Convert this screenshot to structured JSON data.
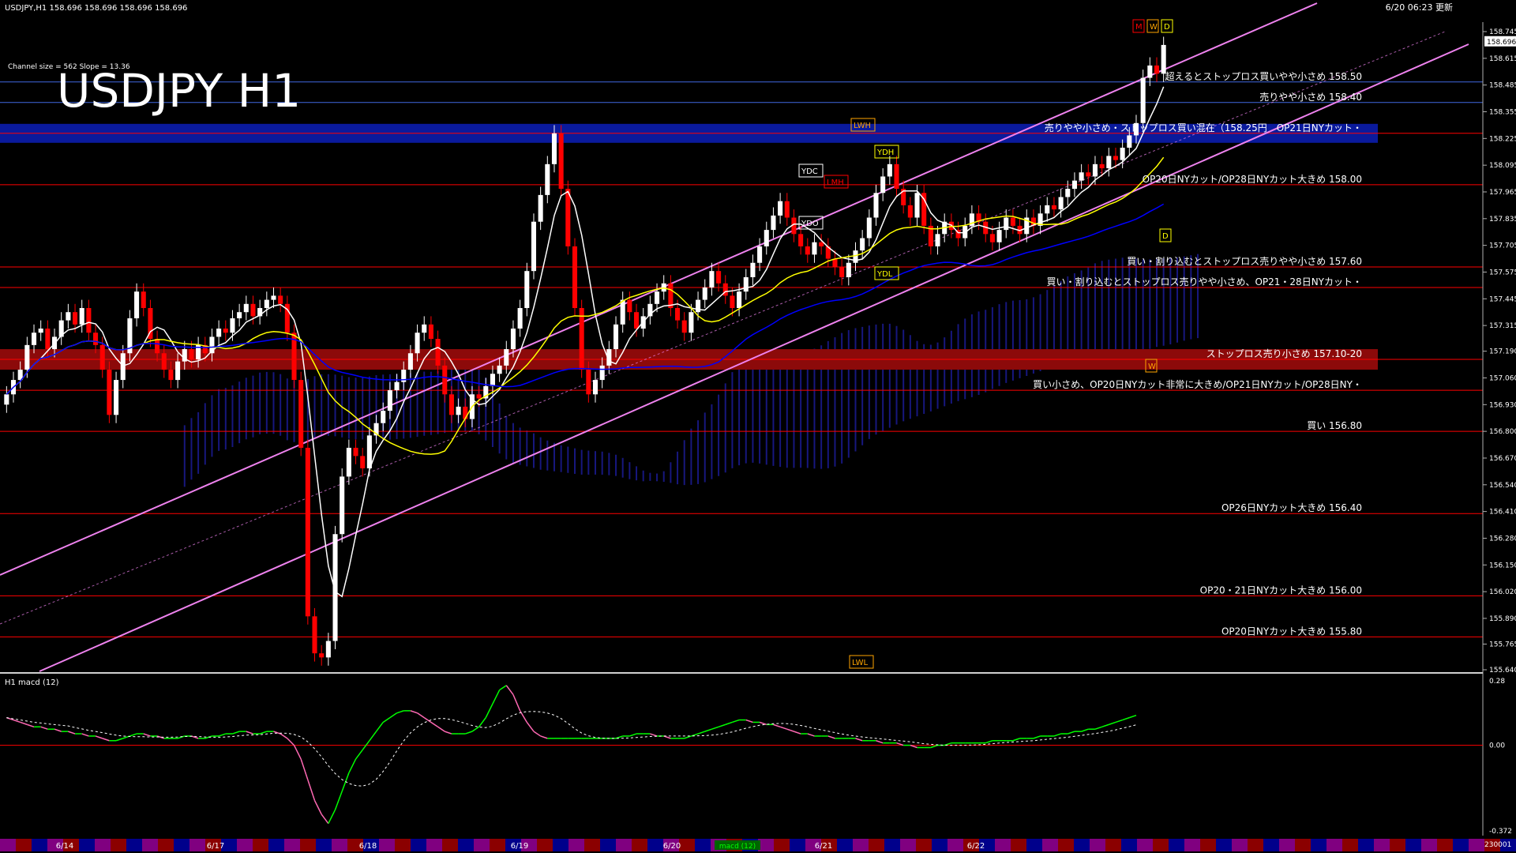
{
  "header": {
    "symbol_info": "USDJPY,H1 158.696 158.696 158.696 158.696",
    "timestamp": "6/20 06:23 更新",
    "channel_info": "Channel size = 562 Slope = 13.36"
  },
  "colors": {
    "background": "#000000",
    "bull_candle": "#ffffff",
    "bear_candle": "#ff0000",
    "kumo_bull": "#1a1a8c",
    "kumo_bear": "#8c1a1a",
    "channel": "#ee82ee",
    "ma_fast": "#ffffff",
    "ma_mid": "#ffff00",
    "ma_slow": "#0000ff",
    "macd_up": "#00ff00",
    "macd_down": "#ff69b4",
    "level_line": "#ff0000",
    "zone_blue": "#0a1a9c",
    "zone_red": "#8c0a0a"
  },
  "chart_data": {
    "type": "candlestick",
    "title": "USDJPY H1",
    "price_axis": {
      "ylim": [
        155.64,
        158.745
      ],
      "ticks": [
        "158.745",
        "158.615",
        "158.485",
        "158.355",
        "158.225",
        "158.095",
        "157.965",
        "157.835",
        "157.705",
        "157.575",
        "157.445",
        "157.315",
        "157.190",
        "157.060",
        "156.930",
        "156.800",
        "156.670",
        "156.540",
        "156.410",
        "156.280",
        "156.150",
        "156.020",
        "155.890",
        "155.765",
        "155.640"
      ],
      "current_price": "158.696"
    },
    "date_labels": [
      "6/14",
      "6/17",
      "6/18",
      "6/19",
      "6/20",
      "6/21",
      "6/22"
    ],
    "tick_tags": [
      "LWH",
      "YDH",
      "YDC",
      "LMH",
      "YDO",
      "YDL",
      "LWL",
      "M",
      "W",
      "D",
      "D",
      "W"
    ],
    "candles_close": [
      156.98,
      157.05,
      157.1,
      157.22,
      157.28,
      157.3,
      157.2,
      157.26,
      157.34,
      157.38,
      157.32,
      157.4,
      157.28,
      157.22,
      157.1,
      156.88,
      157.05,
      157.18,
      157.35,
      157.48,
      157.4,
      157.25,
      157.18,
      157.1,
      157.05,
      157.14,
      157.2,
      157.15,
      157.22,
      157.18,
      157.26,
      157.3,
      157.28,
      157.35,
      157.38,
      157.42,
      157.36,
      157.4,
      157.44,
      157.46,
      157.42,
      157.28,
      157.05,
      156.72,
      155.9,
      155.72,
      155.7,
      155.78,
      156.3,
      156.58,
      156.72,
      156.68,
      156.62,
      156.78,
      156.84,
      156.9,
      157.0,
      157.04,
      157.1,
      157.18,
      157.28,
      157.32,
      157.25,
      157.12,
      156.98,
      156.88,
      156.92,
      156.86,
      156.98,
      156.96,
      157.02,
      157.08,
      157.12,
      157.2,
      157.3,
      157.4,
      157.58,
      157.82,
      157.95,
      158.1,
      158.25,
      157.98,
      157.7,
      157.4,
      157.1,
      156.98,
      157.05,
      157.12,
      157.2,
      157.32,
      157.44,
      157.38,
      157.3,
      157.36,
      157.42,
      157.48,
      157.52,
      157.4,
      157.34,
      157.28,
      157.38,
      157.44,
      157.5,
      157.58,
      157.52,
      157.46,
      157.4,
      157.48,
      157.55,
      157.62,
      157.7,
      157.78,
      157.85,
      157.92,
      157.84,
      157.76,
      157.7,
      157.66,
      157.72,
      157.7,
      157.64,
      157.6,
      157.55,
      157.62,
      157.68,
      157.74,
      157.84,
      157.96,
      158.04,
      158.1,
      157.98,
      157.9,
      157.84,
      157.96,
      157.8,
      157.7,
      157.76,
      157.82,
      157.78,
      157.74,
      157.8,
      157.86,
      157.82,
      157.76,
      157.72,
      157.78,
      157.84,
      157.8,
      157.76,
      157.84,
      157.8,
      157.86,
      157.9,
      157.88,
      157.94,
      157.98,
      158.02,
      158.06,
      158.04,
      158.1,
      158.08,
      158.14,
      158.12,
      158.18,
      158.24,
      158.3,
      158.52,
      158.58,
      158.54,
      158.68
    ],
    "levels": [
      {
        "price": 158.5,
        "label": "超えるとストップロス買いやや小さめ 158.50"
      },
      {
        "price": 158.4,
        "label": "売りやや小さめ 158.40"
      },
      {
        "price": 158.25,
        "label": "売りやや小さめ・ストップロス買い混在（158.25円　OP21日NYカット・"
      },
      {
        "price": 158.0,
        "label": "OP20日NYカット/OP28日NYカット大きめ 158.00"
      },
      {
        "price": 157.6,
        "label": "買い・割り込むとストップロス売りやや小さめ 157.60"
      },
      {
        "price": 157.5,
        "label": "買い・割り込むとストップロス売りやや小さめ、OP21・28日NYカット・"
      },
      {
        "price": 157.15,
        "label": "ストップロス売り小さめ 157.10-20"
      },
      {
        "price": 157.0,
        "label": "買い小さめ、OP20日NYカット非常に大きめ/OP21日NYカット/OP28日NY・"
      },
      {
        "price": 156.8,
        "label": "買い 156.80"
      },
      {
        "price": 156.4,
        "label": "OP26日NYカット大きめ 156.40"
      },
      {
        "price": 156.0,
        "label": "OP20・21日NYカット大きめ 156.00"
      },
      {
        "price": 155.8,
        "label": "OP20日NYカット大きめ 155.80"
      }
    ],
    "macd": {
      "label": "H1 macd (12)",
      "ticks": [
        "0.28",
        "0.00",
        "-0.372"
      ],
      "ylim": [
        -0.372,
        0.28
      ],
      "values": [
        0.12,
        0.11,
        0.1,
        0.09,
        0.08,
        0.08,
        0.07,
        0.07,
        0.06,
        0.06,
        0.05,
        0.05,
        0.04,
        0.04,
        0.03,
        0.02,
        0.02,
        0.03,
        0.04,
        0.05,
        0.05,
        0.04,
        0.04,
        0.03,
        0.03,
        0.03,
        0.04,
        0.04,
        0.03,
        0.03,
        0.04,
        0.04,
        0.05,
        0.05,
        0.06,
        0.06,
        0.05,
        0.05,
        0.06,
        0.06,
        0.05,
        0.03,
        0.0,
        -0.06,
        -0.15,
        -0.24,
        -0.3,
        -0.34,
        -0.28,
        -0.2,
        -0.12,
        -0.06,
        -0.02,
        0.02,
        0.06,
        0.1,
        0.12,
        0.14,
        0.15,
        0.15,
        0.14,
        0.12,
        0.1,
        0.08,
        0.06,
        0.05,
        0.05,
        0.05,
        0.06,
        0.08,
        0.12,
        0.18,
        0.24,
        0.26,
        0.22,
        0.15,
        0.1,
        0.06,
        0.04,
        0.03,
        0.03,
        0.03,
        0.03,
        0.03,
        0.03,
        0.03,
        0.03,
        0.03,
        0.03,
        0.03,
        0.04,
        0.04,
        0.05,
        0.05,
        0.05,
        0.04,
        0.04,
        0.03,
        0.03,
        0.03,
        0.04,
        0.05,
        0.06,
        0.07,
        0.08,
        0.09,
        0.1,
        0.11,
        0.11,
        0.1,
        0.1,
        0.09,
        0.09,
        0.08,
        0.07,
        0.06,
        0.05,
        0.05,
        0.04,
        0.04,
        0.04,
        0.03,
        0.03,
        0.03,
        0.03,
        0.02,
        0.02,
        0.02,
        0.01,
        0.01,
        0.01,
        0.0,
        0.0,
        -0.01,
        -0.01,
        -0.01,
        0.0,
        0.0,
        0.01,
        0.01,
        0.01,
        0.01,
        0.01,
        0.01,
        0.02,
        0.02,
        0.02,
        0.02,
        0.03,
        0.03,
        0.03,
        0.04,
        0.04,
        0.04,
        0.05,
        0.05,
        0.06,
        0.06,
        0.07,
        0.07,
        0.08,
        0.09,
        0.1,
        0.11,
        0.12,
        0.13
      ]
    }
  },
  "bottom_bar": {
    "left_code": "230001",
    "macd_tab": "macd (12)"
  }
}
